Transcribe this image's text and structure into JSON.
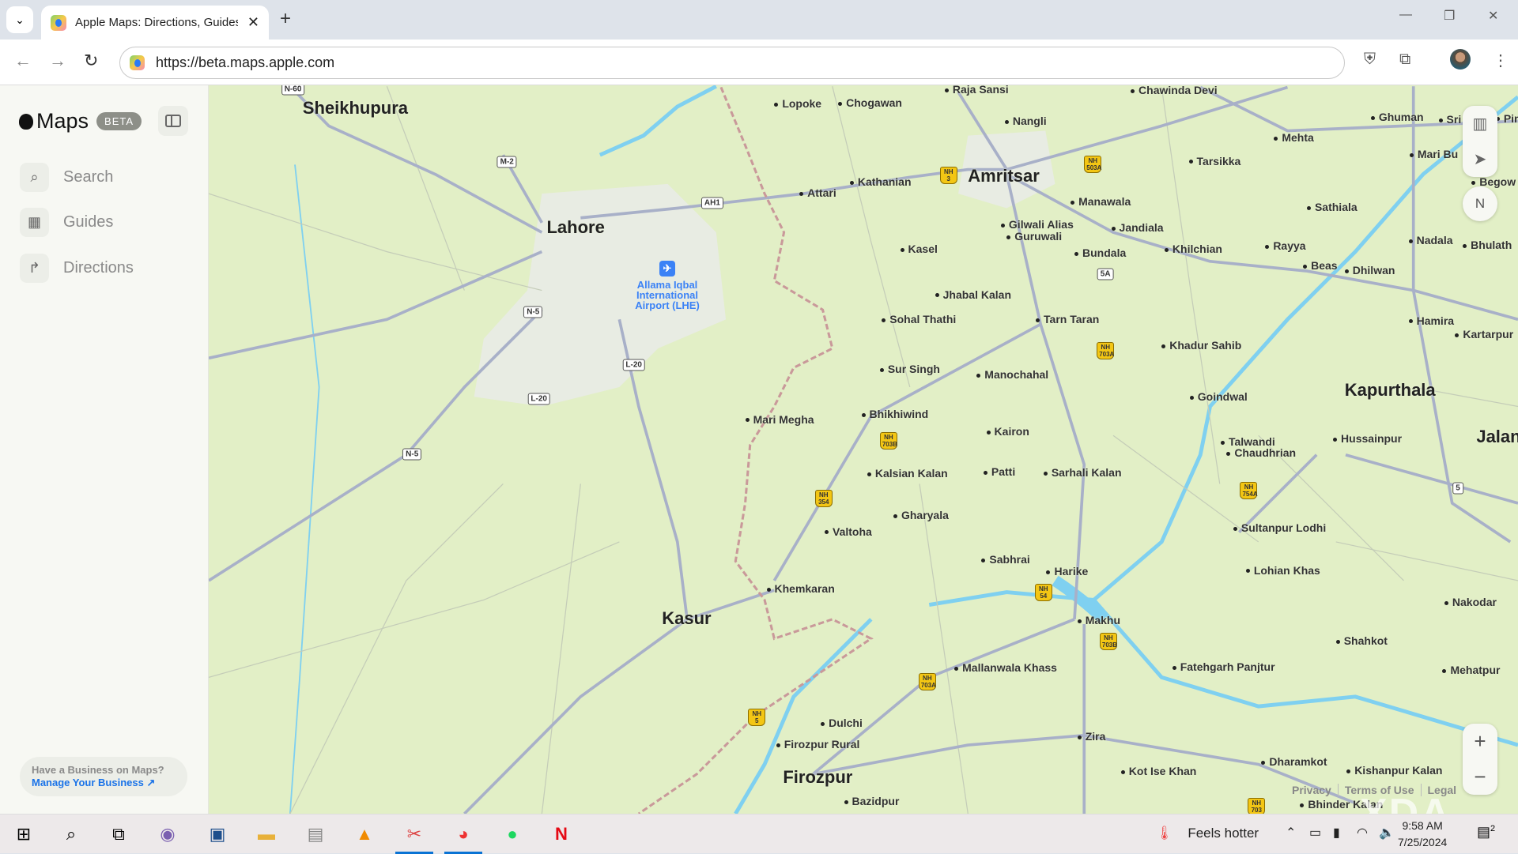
{
  "browser": {
    "tab_title": "Apple Maps: Directions, Guides",
    "url": "https://beta.maps.apple.com"
  },
  "sidebar": {
    "logo": "Maps",
    "badge": "BETA",
    "items": [
      {
        "label": "Search",
        "icon": "search-icon"
      },
      {
        "label": "Guides",
        "icon": "grid-icon"
      },
      {
        "label": "Directions",
        "icon": "directions-arrow-icon"
      }
    ],
    "promo": {
      "question": "Have a Business on Maps?",
      "link": "Manage Your Business ↗"
    }
  },
  "map": {
    "cities": [
      "Lahore",
      "Amritsar",
      "Kasur",
      "Firozpur",
      "Kapurthala",
      "Sheikhupura",
      "Jalan"
    ],
    "places": [
      "Lopoke",
      "Chogawan",
      "Raja Sansi",
      "Chawinda Devi",
      "Nangli",
      "Ghuman",
      "Mehta",
      "Tarsikka",
      "Attari",
      "Kathanian",
      "Manawala",
      "Sathiala",
      "Gilwali Alias",
      "Guruwali",
      "Jandiala",
      "Khilchian",
      "Rayya",
      "Nadala",
      "Bhulath",
      "Kasel",
      "Bundala",
      "Beas",
      "Dhilwan",
      "Jhabal Kalan",
      "Sohal Thathi",
      "Tarn Taran",
      "Hamira",
      "Kartarpur",
      "Khadur Sahib",
      "Sur Singh",
      "Manochahal",
      "Goindwal",
      "Mari Megha",
      "Bhikhiwind",
      "Kairon",
      "Talwandi",
      "Chaudhrian",
      "Hussainpur",
      "Patti",
      "Sarhali Kalan",
      "Kalsian Kalan",
      "Gharyala",
      "Valtoha",
      "Sultanpur Lodhi",
      "Sabhrai",
      "Harike",
      "Lohian Khas",
      "Khemkaran",
      "Makhu",
      "Nakodar",
      "Shahkot",
      "Mallanwala Khass",
      "Fatehgarh Panjtur",
      "Mehatpur",
      "Dulchi",
      "Zira",
      "Firozpur Rural",
      "Dharamkot",
      "Kishanpur Kalan",
      "Kot Ise Khan",
      "Bazidpur",
      "Bhinder Kalan",
      "Mari Bu",
      "Sri",
      "Begow",
      "Pindi"
    ],
    "shields": [
      "N-60",
      "M-2",
      "AH1",
      "N-5",
      "L-20",
      "L-20",
      "N-5",
      "5A",
      "5"
    ],
    "nh_shields": [
      "NH 3",
      "NH 503A",
      "NH 703A",
      "NH 703B",
      "NH 354",
      "NH 54",
      "NH 703B",
      "NH 703A",
      "NH 5",
      "NH 754A",
      "NH 703"
    ],
    "airport": "Allama Iqbal International Airport (LHE)",
    "compass": "N",
    "zoom_in": "+",
    "zoom_out": "−",
    "legal": [
      "Privacy",
      "Terms of Use",
      "Legal"
    ],
    "colors": {
      "land": "#e2efc6",
      "water": "#7fd0f0",
      "road": "#a8b0c8",
      "border": "#c9999a"
    }
  },
  "watermark": "XDA",
  "taskbar": {
    "weather": "Feels hotter",
    "time": "9:58 AM",
    "date": "7/25/2024",
    "notifications": "2"
  }
}
